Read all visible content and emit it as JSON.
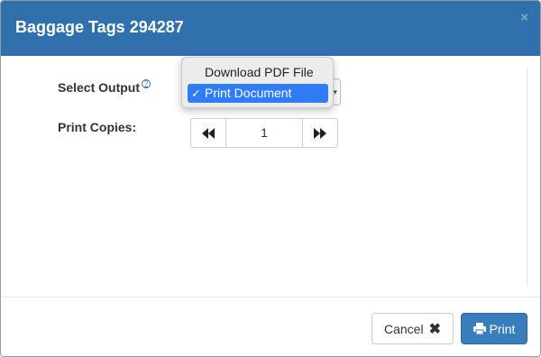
{
  "dialog": {
    "title": "Baggage Tags 294287",
    "close_glyph": "×"
  },
  "form": {
    "output_label": "Select Output",
    "help_glyph": "?",
    "copies_label": "Print Copies:",
    "output_select": {
      "options": [
        "Download PDF File",
        "Print Document"
      ],
      "selected": "Print Document",
      "check_glyph": "✓"
    },
    "copies": {
      "value": "1"
    }
  },
  "footer": {
    "cancel_label": "Cancel",
    "print_label": "Print"
  },
  "colors": {
    "header_bg": "#3071ad",
    "primary_button": "#3a7dbd",
    "dropdown_highlight": "#2f7cf6"
  },
  "icons": {
    "close": "close-icon",
    "help": "help-icon",
    "prev": "double-chevron-left-icon",
    "next": "double-chevron-right-icon",
    "cancel": "x-icon",
    "print": "printer-icon"
  }
}
